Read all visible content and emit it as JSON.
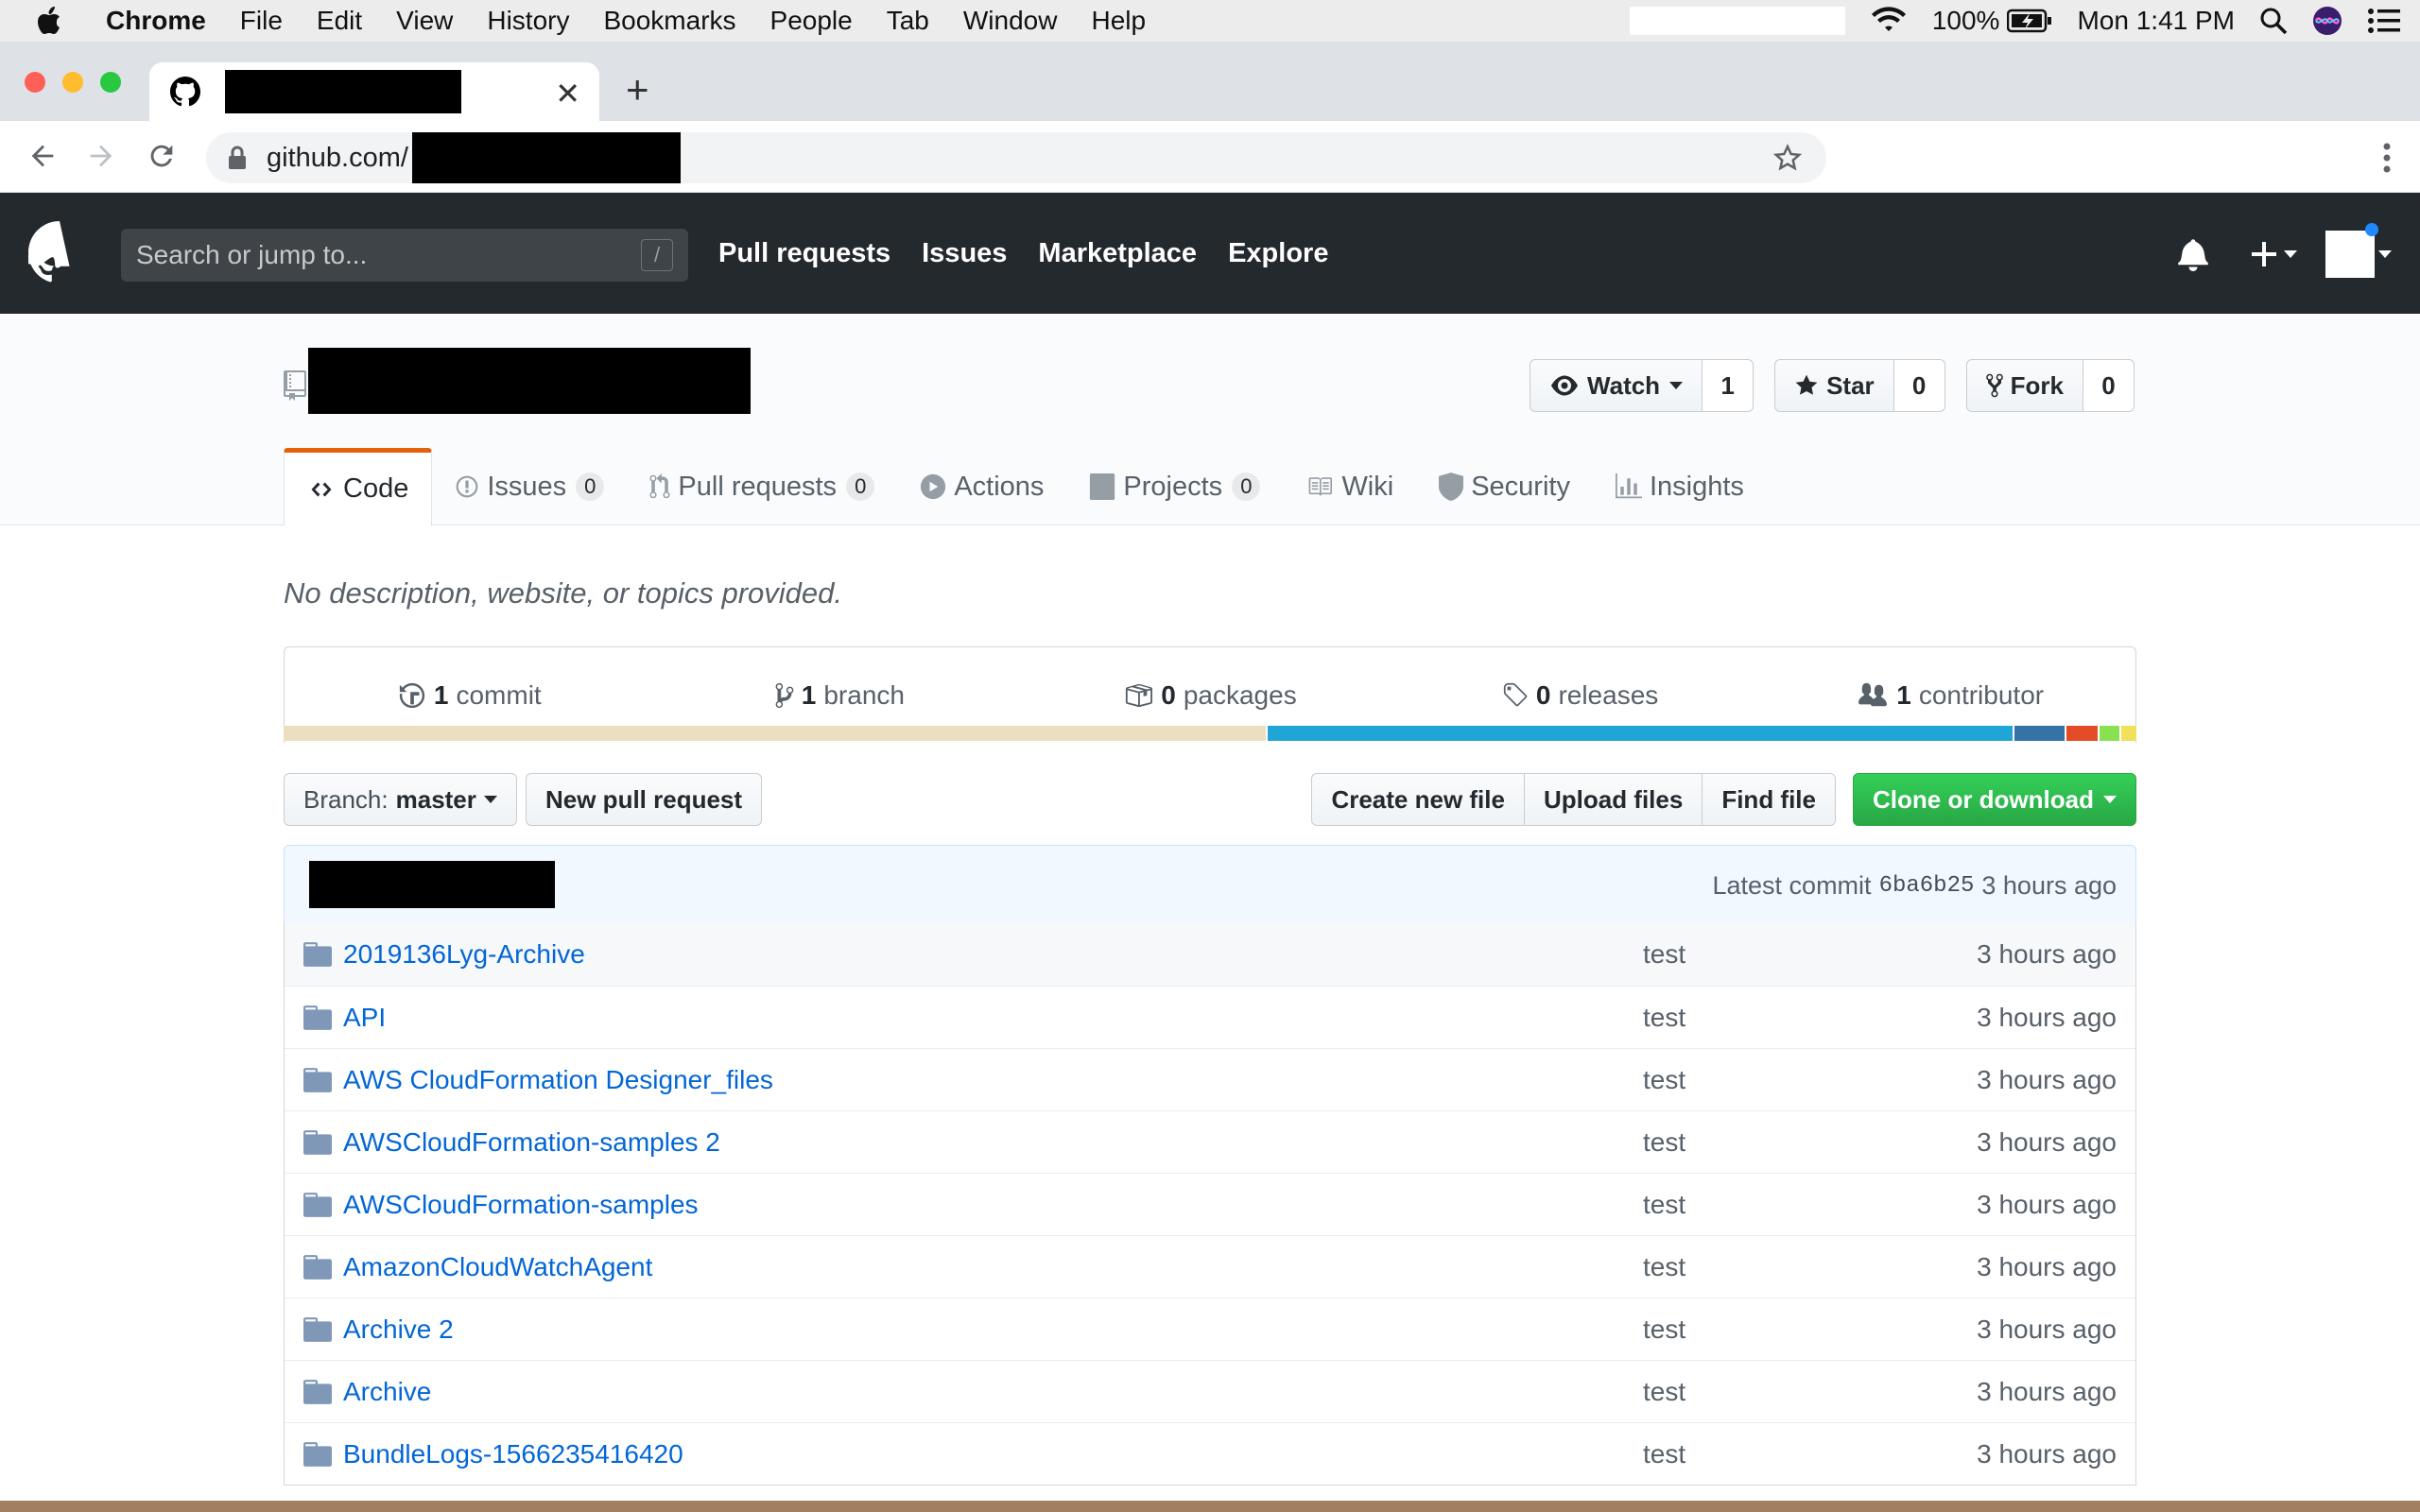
{
  "menubar": {
    "app": "Chrome",
    "items": [
      "File",
      "Edit",
      "View",
      "History",
      "Bookmarks",
      "People",
      "Tab",
      "Window",
      "Help"
    ],
    "battery": "100%",
    "clock": "Mon 1:41 PM"
  },
  "browser": {
    "url_prefix": "github.com/"
  },
  "github": {
    "search_placeholder": "Search or jump to...",
    "slash_key": "/",
    "nav": [
      "Pull requests",
      "Issues",
      "Marketplace",
      "Explore"
    ]
  },
  "repo": {
    "watch_label": "Watch",
    "watch_count": "1",
    "star_label": "Star",
    "star_count": "0",
    "fork_label": "Fork",
    "fork_count": "0",
    "tabs": {
      "code": "Code",
      "issues": "Issues",
      "issues_count": "0",
      "pulls": "Pull requests",
      "pulls_count": "0",
      "actions": "Actions",
      "projects": "Projects",
      "projects_count": "0",
      "wiki": "Wiki",
      "security": "Security",
      "insights": "Insights"
    },
    "description": "No description, website, or topics provided.",
    "summary": {
      "commits_num": "1",
      "commits_label": "commit",
      "branches_num": "1",
      "branches_label": "branch",
      "packages_num": "0",
      "packages_label": "packages",
      "releases_num": "0",
      "releases_label": "releases",
      "contributors_num": "1",
      "contributors_label": "contributor"
    },
    "language_bar": [
      {
        "color": "#ebdec1",
        "percent": 53.0
      },
      {
        "color": "#1fa6d6",
        "percent": 40.3
      },
      {
        "color": "#3572a5",
        "percent": 2.8
      },
      {
        "color": "#e34c26",
        "percent": 1.8
      },
      {
        "color": "#89e051",
        "percent": 1.2
      },
      {
        "color": "#f1e05a",
        "percent": 0.9
      }
    ],
    "branch_label": "Branch:",
    "branch_name": "master",
    "new_pr": "New pull request",
    "create_file": "Create new file",
    "upload_files": "Upload files",
    "find_file": "Find file",
    "clone": "Clone or download",
    "latest_commit_label": "Latest commit",
    "latest_commit_sha": "6ba6b25",
    "latest_commit_age": "3 hours ago",
    "files": [
      {
        "name": "2019136Lyg-Archive",
        "message": "test",
        "age": "3 hours ago"
      },
      {
        "name": "API",
        "message": "test",
        "age": "3 hours ago"
      },
      {
        "name": "AWS CloudFormation Designer_files",
        "message": "test",
        "age": "3 hours ago"
      },
      {
        "name": "AWSCloudFormation-samples 2",
        "message": "test",
        "age": "3 hours ago"
      },
      {
        "name": "AWSCloudFormation-samples",
        "message": "test",
        "age": "3 hours ago"
      },
      {
        "name": "AmazonCloudWatchAgent",
        "message": "test",
        "age": "3 hours ago"
      },
      {
        "name": "Archive 2",
        "message": "test",
        "age": "3 hours ago"
      },
      {
        "name": "Archive",
        "message": "test",
        "age": "3 hours ago"
      },
      {
        "name": "BundleLogs-1566235416420",
        "message": "test",
        "age": "3 hours ago"
      }
    ]
  }
}
